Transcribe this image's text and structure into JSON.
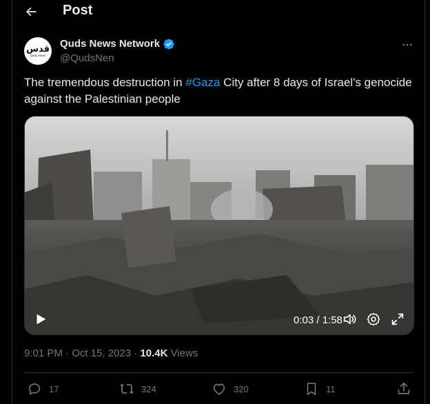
{
  "header": {
    "title": "Post",
    "back_icon": "arrow-left-icon"
  },
  "author": {
    "name": "Quds News Network",
    "handle": "@QudsNen",
    "avatar_logo": "قدس",
    "avatar_sub": "Quds News",
    "verified": true
  },
  "tweet": {
    "text_before": "The tremendous destruction in ",
    "hashtag": "#Gaza",
    "text_after": " City after 8 days of Israel's genocide against the Palestinian people"
  },
  "video": {
    "time": "0:03 / 1:58",
    "progress_fraction": 0.025
  },
  "meta": {
    "timestamp": "9:01 PM · Oct 15, 2023 · ",
    "views_count": "10.4K",
    "views_label": " Views"
  },
  "actions": {
    "replies": "17",
    "reposts": "324",
    "likes": "320",
    "bookmarks": "11"
  },
  "colors": {
    "accent": "#1d9bf0",
    "background": "#000000",
    "secondary_text": "#71767b",
    "border": "#2f3336"
  }
}
